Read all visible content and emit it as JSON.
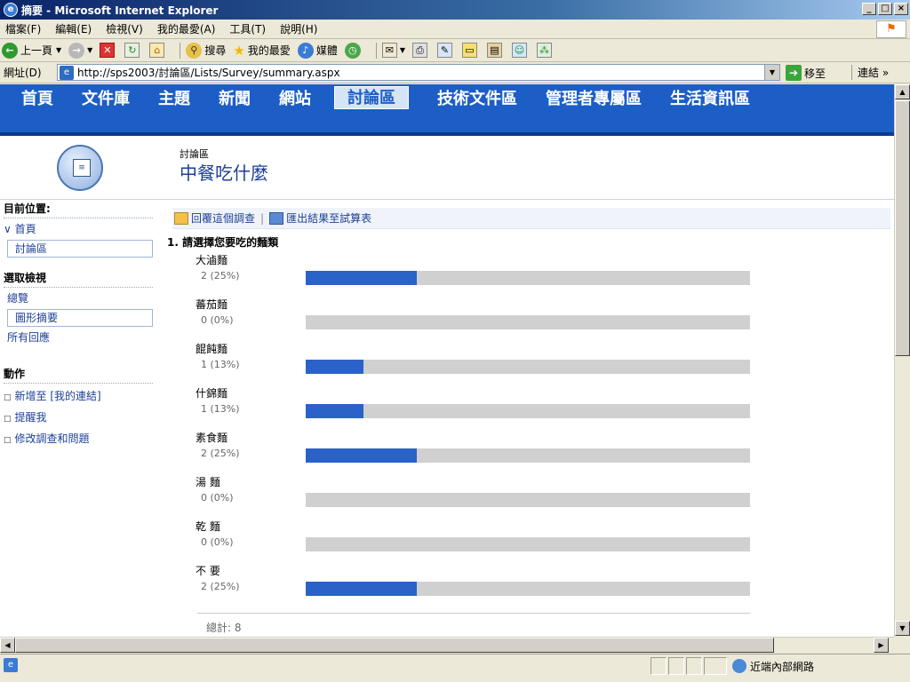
{
  "window": {
    "title": "摘要 - Microsoft Internet Explorer",
    "minimize": "_",
    "maximize": "□",
    "close": "×"
  },
  "menu": [
    "檔案(F)",
    "編輯(E)",
    "檢視(V)",
    "我的最愛(A)",
    "工具(T)",
    "說明(H)"
  ],
  "toolbar": {
    "back": "上一頁",
    "search": "搜尋",
    "favorites": "我的最愛",
    "media": "媒體"
  },
  "address": {
    "label": "網址(D)",
    "url": "http://sps2003/討論區/Lists/Survey/summary.aspx",
    "go": "移至",
    "links": "連結"
  },
  "topnav": [
    "首頁",
    "文件庫",
    "主題",
    "新聞",
    "網站",
    "討論區",
    "技術文件區",
    "管理者專屬區",
    "生活資訊區"
  ],
  "header": {
    "section": "討論區",
    "title": "中餐吃什麼"
  },
  "leftnav": {
    "location_heading": "目前位置:",
    "home": "首頁",
    "current": "討論區",
    "views_heading": "選取檢視",
    "views": [
      "總覽",
      "圖形摘要",
      "所有回應"
    ],
    "actions_heading": "動作",
    "actions": [
      "新增至 [我的連結]",
      "提醒我",
      "修改調查和問題"
    ]
  },
  "actions": {
    "respond": "回覆這個調查",
    "export": "匯出結果至試算表"
  },
  "survey": {
    "question": "1. 請選擇您要吃的麵類",
    "options": [
      {
        "label": "大滷麵",
        "count": "2 (25%)",
        "percent": 25
      },
      {
        "label": "蕃茄麵",
        "count": "0 (0%)",
        "percent": 0
      },
      {
        "label": "餛飩麵",
        "count": "1 (13%)",
        "percent": 13
      },
      {
        "label": "什錦麵",
        "count": "1 (13%)",
        "percent": 13
      },
      {
        "label": "素食麵",
        "count": "2 (25%)",
        "percent": 25
      },
      {
        "label": "湯 麵",
        "count": "0 (0%)",
        "percent": 0
      },
      {
        "label": "乾 麵",
        "count": "0 (0%)",
        "percent": 0
      },
      {
        "label": "不 要",
        "count": "2 (25%)",
        "percent": 25
      }
    ],
    "total": "總計: 8"
  },
  "status": {
    "zone": "近端內部網路"
  },
  "colors": {
    "nav_blue": "#1c5ec6",
    "bar_fill": "#2b62c8",
    "bar_track": "#d0d0d0",
    "title_blue": "#1c3f94"
  }
}
